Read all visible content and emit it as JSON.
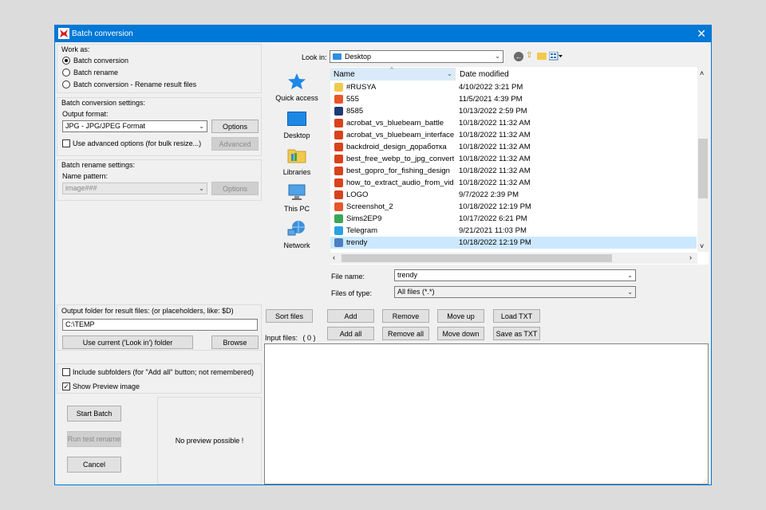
{
  "window": {
    "title": "Batch conversion",
    "close_glyph": "✕"
  },
  "work_as": {
    "label": "Work as:",
    "options": [
      {
        "label": "Batch conversion",
        "selected": true
      },
      {
        "label": "Batch rename",
        "selected": false
      },
      {
        "label": "Batch conversion - Rename result files",
        "selected": false
      }
    ]
  },
  "conversion": {
    "label": "Batch conversion settings:",
    "output_format_label": "Output format:",
    "output_format_value": "JPG - JPG/JPEG Format",
    "options_button": "Options",
    "advanced_checkbox": "Use advanced options (for bulk resize...)",
    "advanced_button": "Advanced"
  },
  "rename": {
    "label": "Batch rename settings:",
    "pattern_label": "Name pattern:",
    "pattern_value": "image###",
    "options_button": "Options"
  },
  "output": {
    "label": "Output folder for result files: (or placeholders, like: $D)",
    "folder_value": "C:\\TEMP",
    "use_current_button": "Use current ('Look in') folder",
    "browse_button": "Browse"
  },
  "flags": {
    "include_subfolders": {
      "label": "Include subfolders (for \"Add all\" button; not remembered)",
      "checked": false
    },
    "show_preview": {
      "label": "Show Preview image",
      "checked": true
    }
  },
  "actions": {
    "start_batch": "Start Batch",
    "run_test_rename": "Run test rename",
    "cancel": "Cancel"
  },
  "preview": {
    "text": "No preview possible !"
  },
  "browser": {
    "look_in_label": "Look in:",
    "look_in_value": "Desktop",
    "places": [
      {
        "label": "Quick access",
        "icon": "star-icon"
      },
      {
        "label": "Desktop",
        "icon": "desktop-icon"
      },
      {
        "label": "Libraries",
        "icon": "folder-icon"
      },
      {
        "label": "This PC",
        "icon": "computer-icon"
      },
      {
        "label": "Network",
        "icon": "network-icon"
      }
    ],
    "columns": [
      "Name",
      "Date modified"
    ],
    "files": [
      {
        "name": "#RUSYA",
        "date": "4/10/2022 3:21 PM",
        "icon_color": "#f2c94c"
      },
      {
        "name": "555",
        "date": "11/5/2021 4:39 PM",
        "icon_color": "#e8562a"
      },
      {
        "name": "8585",
        "date": "10/13/2022 2:59 PM",
        "icon_color": "#1f3b73"
      },
      {
        "name": "acrobat_vs_bluebeam_battle",
        "date": "10/18/2022 11:32 AM",
        "icon_color": "#d9421c"
      },
      {
        "name": "acrobat_vs_bluebeam_interface",
        "date": "10/18/2022 11:32 AM",
        "icon_color": "#d9421c"
      },
      {
        "name": "backdroid_design_доработка",
        "date": "10/18/2022 11:32 AM",
        "icon_color": "#d9421c"
      },
      {
        "name": "best_free_webp_to_jpg_convert...",
        "date": "10/18/2022 11:32 AM",
        "icon_color": "#d9421c"
      },
      {
        "name": "best_gopro_for_fishing_design",
        "date": "10/18/2022 11:32 AM",
        "icon_color": "#d9421c"
      },
      {
        "name": "how_to_extract_audio_from_vid...",
        "date": "10/18/2022 11:32 AM",
        "icon_color": "#d9421c"
      },
      {
        "name": "LOGO",
        "date": "9/7/2022 2:39 PM",
        "icon_color": "#d9421c"
      },
      {
        "name": "Screenshot_2",
        "date": "10/18/2022 12:19 PM",
        "icon_color": "#e8562a"
      },
      {
        "name": "Sims2EP9",
        "date": "10/17/2022 6:21 PM",
        "icon_color": "#3aa657"
      },
      {
        "name": "Telegram",
        "date": "9/21/2021 11:03 PM",
        "icon_color": "#2aa3e0"
      },
      {
        "name": "trendy",
        "date": "10/18/2022 12:19 PM",
        "icon_color": "#4a7fc1",
        "selected": true
      }
    ],
    "file_name_label": "File name:",
    "file_name_value": "trendy",
    "files_of_type_label": "Files of type:",
    "files_of_type_value": "All files (*.*)"
  },
  "list_buttons": {
    "sort_files": "Sort files",
    "add": "Add",
    "remove": "Remove",
    "move_up": "Move up",
    "load_txt": "Load TXT",
    "add_all": "Add all",
    "remove_all": "Remove all",
    "move_down": "Move down",
    "save_as_txt": "Save as TXT"
  },
  "input_files": {
    "label": "Input files:",
    "count": "( 0 )"
  },
  "colors": {
    "accent": "#0078d7",
    "selection": "#cce8ff"
  }
}
